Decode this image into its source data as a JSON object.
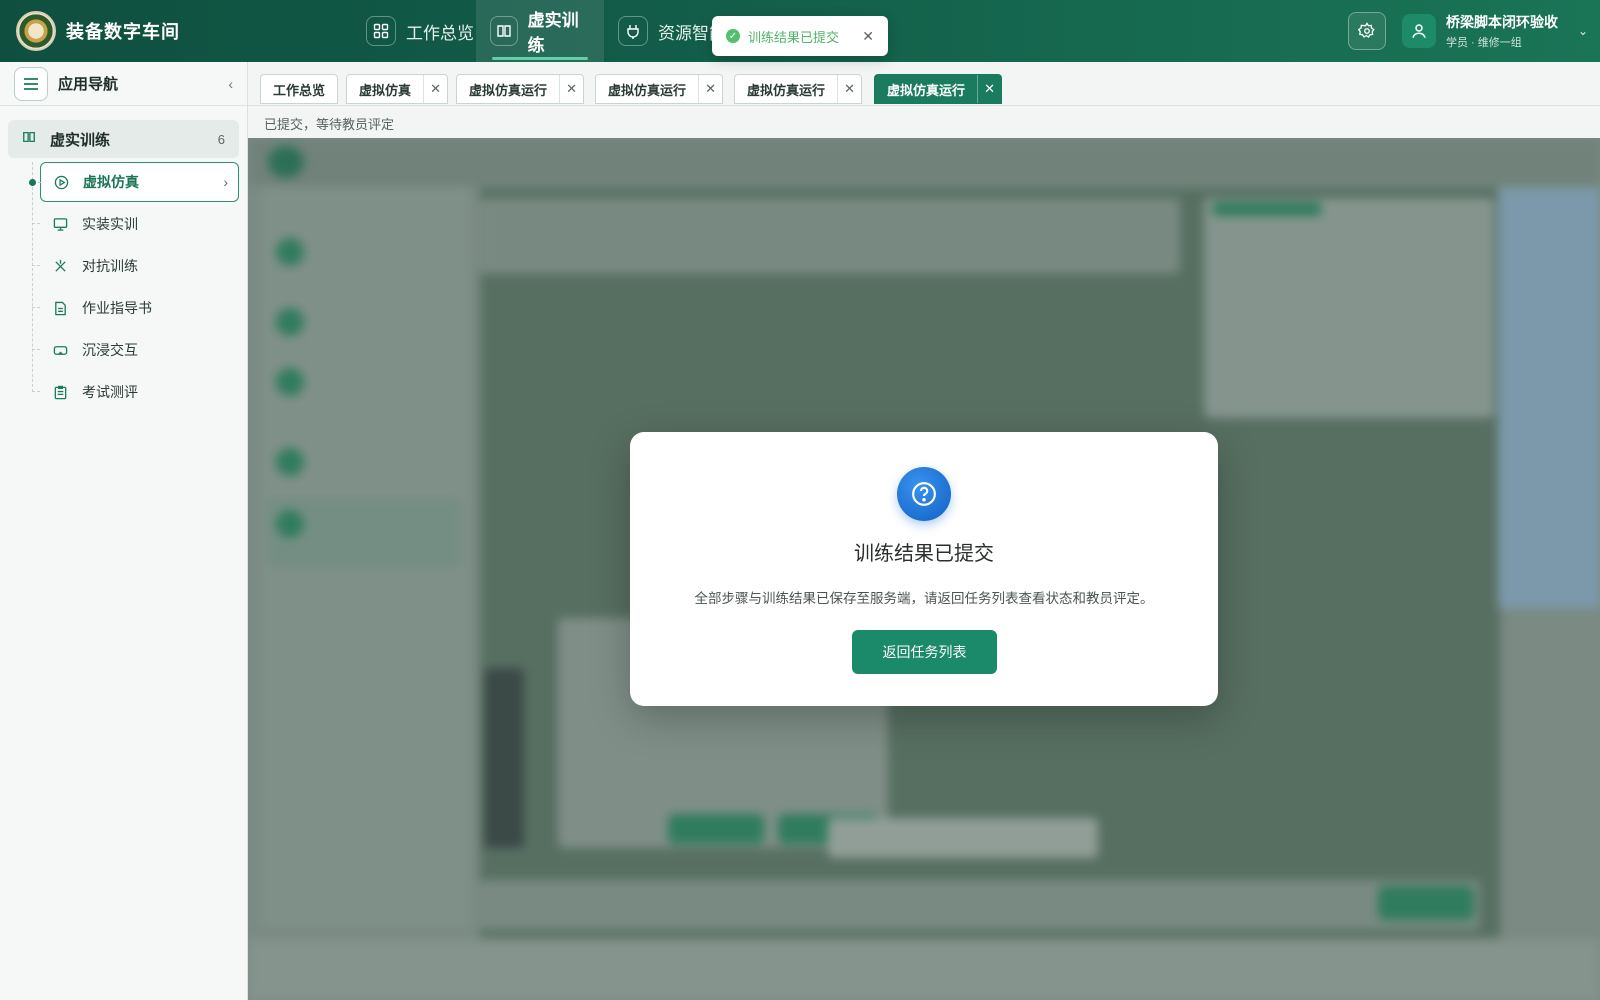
{
  "app": {
    "title": "装备数字车间"
  },
  "topnav": [
    {
      "label": "工作总览",
      "icon": "grid-icon"
    },
    {
      "label": "虚实训练",
      "icon": "book-icon"
    },
    {
      "label": "资源智能",
      "icon": "plug-icon"
    }
  ],
  "toast": {
    "text": "训练结果已提交"
  },
  "user": {
    "name": "桥梁脚本闭环验收",
    "role": "学员 · 维修一组"
  },
  "sidebar": {
    "title": "应用导航",
    "group": {
      "label": "虚实训练",
      "count": "6"
    },
    "items": [
      {
        "label": "虚拟仿真",
        "icon": "play-circle-icon"
      },
      {
        "label": "实装实训",
        "icon": "monitor-icon"
      },
      {
        "label": "对抗训练",
        "icon": "versus-icon"
      },
      {
        "label": "作业指导书",
        "icon": "document-icon"
      },
      {
        "label": "沉浸交互",
        "icon": "vr-headset-icon"
      },
      {
        "label": "考试测评",
        "icon": "clipboard-icon"
      }
    ]
  },
  "page_tabs": [
    {
      "label": "工作总览",
      "closable": false
    },
    {
      "label": "虚拟仿真",
      "closable": true
    },
    {
      "label": "虚拟仿真运行",
      "closable": true
    },
    {
      "label": "虚拟仿真运行",
      "closable": true
    },
    {
      "label": "虚拟仿真运行",
      "closable": true
    },
    {
      "label": "虚拟仿真运行",
      "closable": true
    }
  ],
  "status_text": "已提交，等待教员评定",
  "modal": {
    "title": "训练结果已提交",
    "message": "全部步骤与训练结果已保存至服务端，请返回任务列表查看状态和教员评定。",
    "button": "返回任务列表"
  },
  "colors": {
    "brand": "#1a7b5f",
    "header": "#125c49",
    "accent_blue": "#1c6fd0",
    "success": "#52c06c"
  }
}
